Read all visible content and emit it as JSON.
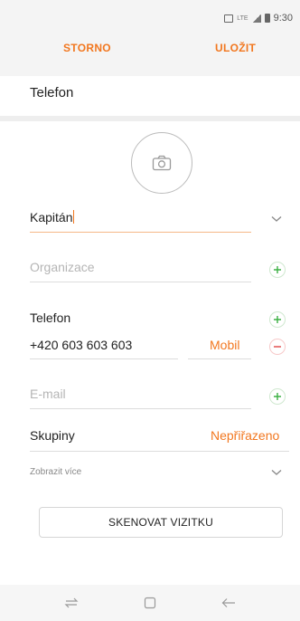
{
  "status_bar": {
    "time": "9:30",
    "network_label": "LTE"
  },
  "header": {
    "cancel_label": "STORNO",
    "save_label": "ULOŽIT"
  },
  "account": {
    "title": "Telefon"
  },
  "form": {
    "name_value": "Kapitán",
    "organization_placeholder": "Organizace",
    "phone_section_label": "Telefon",
    "phone_value": "+420 603 603 603",
    "phone_type": "Mobil",
    "email_placeholder": "E-mail",
    "groups_label": "Skupiny",
    "groups_value": "Nepřiřazeno",
    "show_more_label": "Zobrazit více",
    "scan_button_label": "SKENOVAT VIZITKU"
  },
  "colors": {
    "accent": "#f2771f",
    "add": "#3cb043",
    "remove": "#e04646",
    "operator": "#e20074"
  }
}
